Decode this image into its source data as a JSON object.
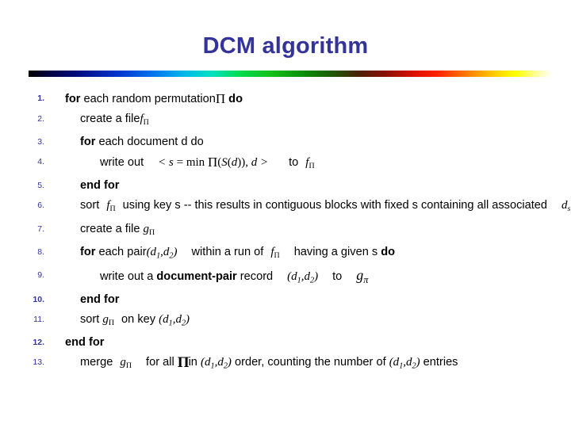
{
  "slide": {
    "title": "DCM algorithm",
    "title_color": "#333399",
    "divider": "rainbow-gradient-bar"
  },
  "algorithm": {
    "steps": [
      {
        "number": "1.",
        "indent": 0,
        "bold_number": true,
        "text": "for each random permutation ∏ do",
        "parts": [
          {
            "t": "for",
            "style": "bold"
          },
          {
            "t": " each random permutation",
            "style": "plain"
          },
          {
            "t": "∏",
            "style": "math-prod"
          },
          {
            "t": " do",
            "style": "bold"
          }
        ]
      },
      {
        "number": "2.",
        "indent": 1,
        "bold_number": false,
        "text": "create a file fΠ",
        "parts": [
          {
            "t": "create a file",
            "style": "plain"
          },
          {
            "t": "f",
            "style": "math-italic"
          },
          {
            "t": "Π",
            "style": "subscript"
          }
        ]
      },
      {
        "number": "3.",
        "indent": 1,
        "bold_number": false,
        "text": "for each document d do",
        "parts": [
          {
            "t": "for",
            "style": "bold"
          },
          {
            "t": " each document d do",
            "style": "plain"
          }
        ]
      },
      {
        "number": "4.",
        "indent": 2,
        "bold_number": false,
        "text": "write out < s = min ∏(S(d)), d >   to  fΠ",
        "parts": [
          {
            "t": "write out",
            "style": "plain"
          },
          {
            "t": "< s = min ∏(S(d)), d >",
            "style": "math-italic"
          },
          {
            "t": "to",
            "style": "plain"
          },
          {
            "t": "fΠ",
            "style": "math-italic"
          }
        ]
      },
      {
        "number": "5.",
        "indent": 1,
        "bold_number": false,
        "text": "end for",
        "parts": [
          {
            "t": "end for",
            "style": "bold"
          }
        ]
      },
      {
        "number": "6.",
        "indent": 1,
        "bold_number": false,
        "text": "sort fΠ using key s -- this results in contiguous blocks with fixed s containing all associated dₛ",
        "parts": [
          {
            "t": "sort",
            "style": "plain"
          },
          {
            "t": "fΠ",
            "style": "math-italic"
          },
          {
            "t": "using key s -- this results in contiguous blocks with fixed s containing all associated",
            "style": "plain"
          },
          {
            "t": "dₛ",
            "style": "math-italic"
          }
        ]
      },
      {
        "number": "7.",
        "indent": 1,
        "bold_number": false,
        "text": "create a file gΠ",
        "parts": [
          {
            "t": "create a file",
            "style": "plain"
          },
          {
            "t": "gΠ",
            "style": "math-italic"
          }
        ]
      },
      {
        "number": "8.",
        "indent": 1,
        "bold_number": false,
        "text": "for each pair (d₁, d₂) within a run of fΠ having a given s do",
        "parts": [
          {
            "t": "for",
            "style": "bold"
          },
          {
            "t": " each pair",
            "style": "plain"
          },
          {
            "t": "(d₁, d₂)",
            "style": "math-italic"
          },
          {
            "t": "within a run of",
            "style": "plain"
          },
          {
            "t": "fΠ",
            "style": "math-italic"
          },
          {
            "t": "having a given s",
            "style": "plain"
          },
          {
            "t": "do",
            "style": "bold"
          }
        ]
      },
      {
        "number": "9.",
        "indent": 2,
        "bold_number": false,
        "text": "write out a document-pair record (d₁, d₂)  to  gπ",
        "parts": [
          {
            "t": "write out a ",
            "style": "plain"
          },
          {
            "t": "document-pair",
            "style": "bold"
          },
          {
            "t": " record",
            "style": "plain"
          },
          {
            "t": "(d₁, d₂)",
            "style": "math-italic"
          },
          {
            "t": "to",
            "style": "plain"
          },
          {
            "t": "gπ",
            "style": "math-italic-large"
          }
        ]
      },
      {
        "number": "10.",
        "indent": 1,
        "bold_number": true,
        "text": "end for",
        "parts": [
          {
            "t": "end for",
            "style": "bold"
          }
        ]
      },
      {
        "number": "11.",
        "indent": 1,
        "bold_number": false,
        "text": "sort gΠ on key (d₁, d₂)",
        "parts": [
          {
            "t": "sort",
            "style": "plain"
          },
          {
            "t": "gΠ",
            "style": "math-italic"
          },
          {
            "t": "on key",
            "style": "plain"
          },
          {
            "t": "(d₁, d₂)",
            "style": "math-italic"
          }
        ]
      },
      {
        "number": "12.",
        "indent": 0,
        "bold_number": true,
        "text": "end for",
        "parts": [
          {
            "t": "end for",
            "style": "bold"
          }
        ]
      },
      {
        "number": "13.",
        "indent": 1,
        "bold_number": false,
        "text": "merge gΠ for all ∏ in (d₁, d₂) order, counting the number of (d₁, d₂) entries",
        "parts": [
          {
            "t": "merge",
            "style": "plain"
          },
          {
            "t": "gΠ",
            "style": "math-italic"
          },
          {
            "t": "for all",
            "style": "plain"
          },
          {
            "t": "∏",
            "style": "math-prod-big"
          },
          {
            "t": "in",
            "style": "plain"
          },
          {
            "t": "(d₁, d₂)",
            "style": "math-italic"
          },
          {
            "t": "order, counting the number of",
            "style": "plain"
          },
          {
            "t": "(d₁, d₂)",
            "style": "math-italic"
          },
          {
            "t": "entries",
            "style": "plain"
          }
        ]
      }
    ]
  }
}
